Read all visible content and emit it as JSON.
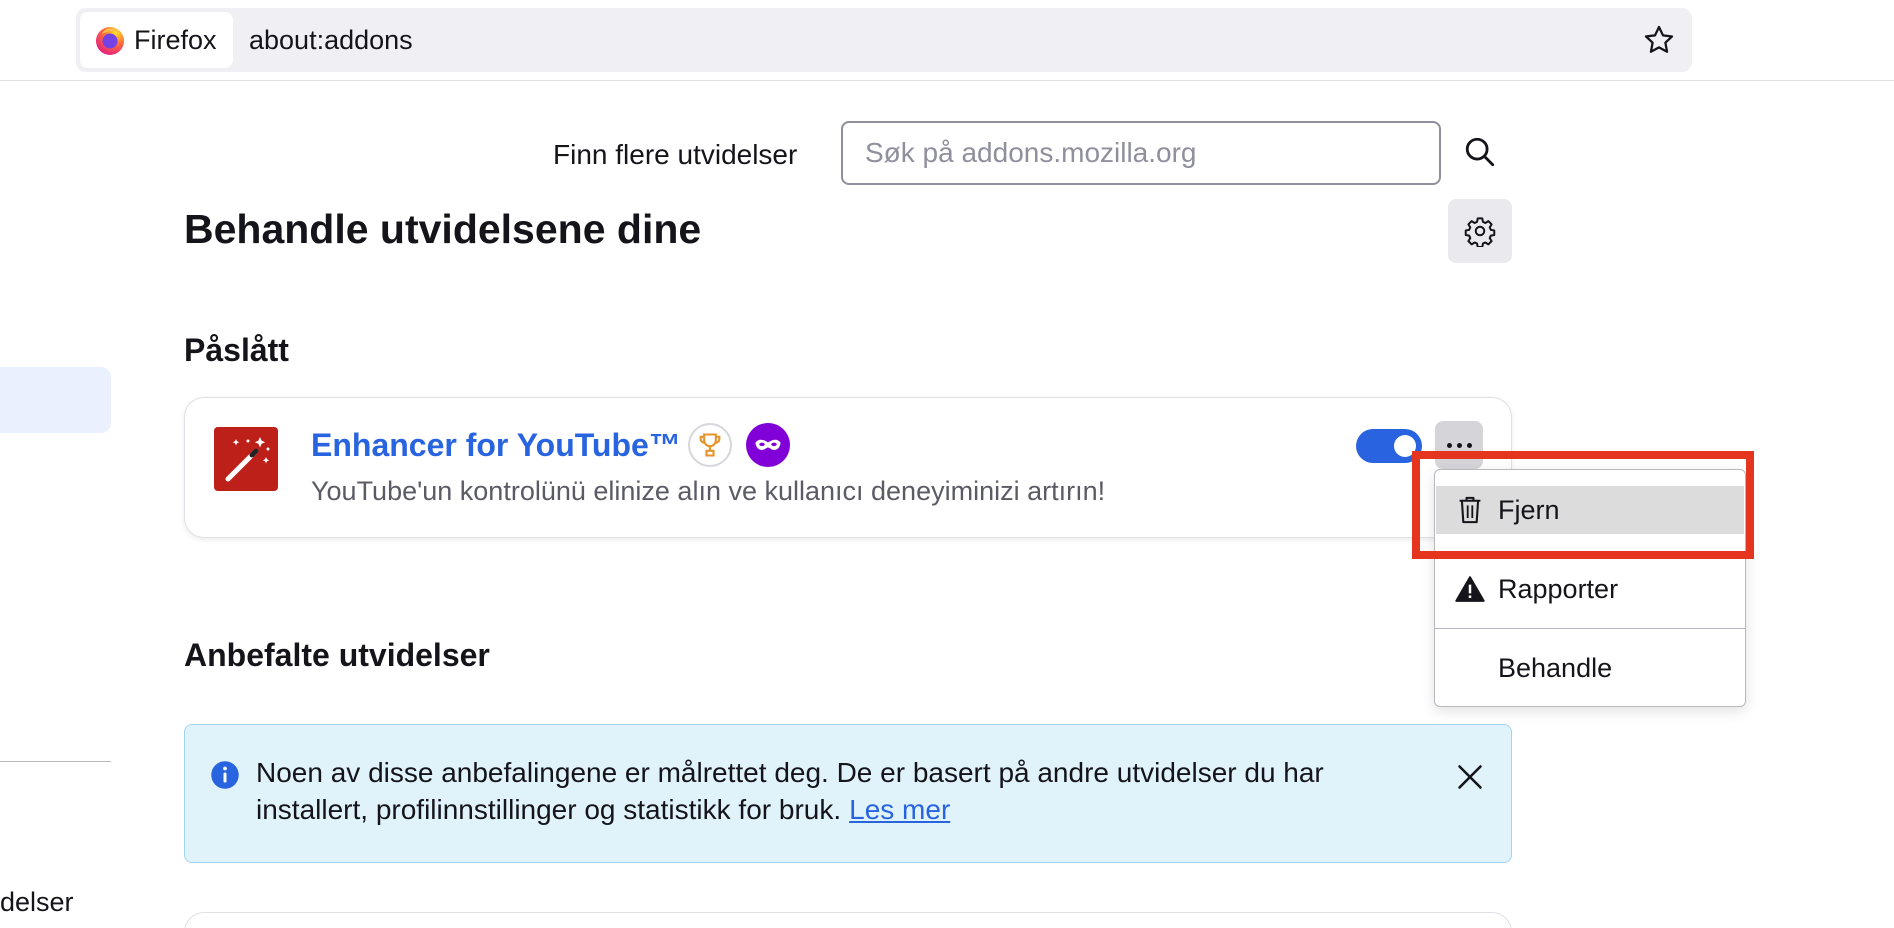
{
  "browser": {
    "identity_label": "Firefox",
    "url": "about:addons"
  },
  "sidebar": {
    "partial_item_label": "delser"
  },
  "search": {
    "label": "Finn flere utvidelser",
    "placeholder": "Søk på addons.mozilla.org"
  },
  "page": {
    "title": "Behandle utvidelsene dine"
  },
  "sections": {
    "enabled_title": "Påslått",
    "recommended_title": "Anbefalte utvidelser"
  },
  "addon": {
    "name": "Enhancer for YouTube™",
    "description": "YouTube'un kontrolünü elinize alın ve kullanıcı deneyiminizi artırın!",
    "enabled": true,
    "badges": [
      "trophy-icon",
      "private-browsing-icon"
    ],
    "icon": "magic-wand-icon"
  },
  "menu": {
    "items": [
      {
        "label": "Fjern",
        "icon": "trash-icon"
      },
      {
        "label": "Rapporter",
        "icon": "warning-icon"
      },
      {
        "label": "Behandle",
        "icon": ""
      }
    ]
  },
  "notice": {
    "text": "Noen av disse anbefalingene er målrettet deg. De er basert på andre utvidelser du har installert, profilinnstillinger og statistikk for bruk.",
    "link": "Les mer"
  },
  "colors": {
    "accent": "#2863e0",
    "highlight": "#e5351f",
    "notice_bg": "#e0f3fb",
    "private_badge": "#8000d7"
  }
}
